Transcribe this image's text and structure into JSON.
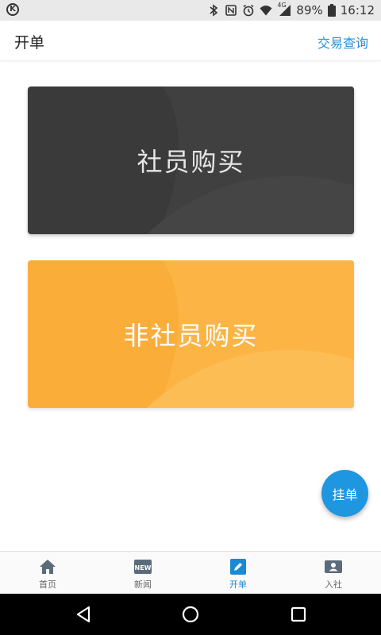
{
  "status_bar": {
    "left_icon": "K",
    "battery": "89%",
    "time": "16:12",
    "network": "4G",
    "icons": [
      "bluetooth-icon",
      "nfc-icon",
      "alarm-icon",
      "wifi-icon",
      "signal-icon",
      "battery-icon"
    ]
  },
  "header": {
    "title": "开单",
    "action_label": "交易查询"
  },
  "main": {
    "member_purchase_label": "社员购买",
    "non_member_purchase_label": "非社员购买"
  },
  "fab": {
    "label": "挂单"
  },
  "tabbar": {
    "items": [
      {
        "label": "首页",
        "icon": "home-icon"
      },
      {
        "label": "新闻",
        "icon": "news-icon",
        "badge": "NEW"
      },
      {
        "label": "开单",
        "icon": "edit-icon"
      },
      {
        "label": "入社",
        "icon": "member-card-icon"
      }
    ],
    "active_index": 2
  },
  "colors": {
    "accent": "#1a8ad4",
    "member_card": "#3a3a3b",
    "non_member_card": "#fbad3a",
    "fab": "#1e97e0"
  }
}
